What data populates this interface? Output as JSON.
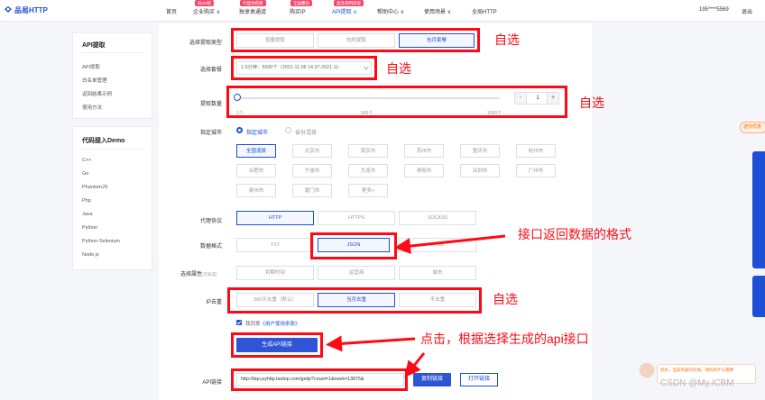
{
  "header": {
    "logo": "品易HTTP",
    "nav": [
      {
        "label": "首页",
        "tag": ""
      },
      {
        "label": "企业购买 ∨",
        "tag": "低40/起"
      },
      {
        "label": "独享类通道",
        "tag": "代理池搭建"
      },
      {
        "label": "购买IP",
        "tag": "全国覆盖"
      },
      {
        "label": "API提取 ∨",
        "tag": "直连调用提取"
      },
      {
        "label": "帮助中心 ∨",
        "tag": ""
      },
      {
        "label": "使用场景 ∨",
        "tag": ""
      },
      {
        "label": "全局HTTP",
        "tag": ""
      }
    ],
    "user": "195****5569",
    "logout": "退出"
  },
  "sidebar_api": {
    "title": "API提取",
    "items": [
      "API提取",
      "白名单管理",
      "返回结果示例",
      "使用方法"
    ]
  },
  "sidebar_demo": {
    "title": "代码接入Demo",
    "items": [
      "C++",
      "Go",
      "PhantomJS",
      "Php",
      "Java",
      "Python",
      "Python-Selenium",
      "Node.js"
    ]
  },
  "form": {
    "package_label": "选择提取类型",
    "package_options": [
      "按量提取",
      "包时提取",
      "包月套餐"
    ],
    "package_selected": 2,
    "choose_label": "选择套餐",
    "choose_value": "1-5分钟：5000个（2021-11-06 14:37-2021-11-",
    "count_label": "提取数量",
    "count_value": "1",
    "slider_min": "1个",
    "slider_mid": "500个",
    "slider_max": "1000个",
    "slider_level": 0,
    "city_label": "指定城市",
    "city_radio1": "指定城市",
    "city_radio2": "省份混拨",
    "cities": [
      "全国混拨",
      "北京市",
      "南京市",
      "苏州市",
      "重庆市",
      "杭州市",
      "合肥市",
      "宁波市",
      "大连市",
      "贵阳市",
      "深圳市",
      "广州市",
      "泉州市",
      "厦门市",
      "更多>"
    ],
    "protocol_label": "代理协议",
    "protocols": [
      "HTTP",
      "HTTPS",
      "SOCKS5"
    ],
    "format_label": "数据格式",
    "formats": [
      "TXT",
      "JSON",
      "HTML"
    ],
    "attr_label": "选择属性",
    "attr_sub": "(可多选)",
    "attrs": [
      "到期时间",
      "运营商",
      "城市"
    ],
    "dedup_label": "IP去重",
    "dedups": [
      "360天去重（默认）",
      "当月去重",
      "不去重"
    ],
    "agree_text": "我同意",
    "agree_link": "《用户使用条款》",
    "generate_btn": "生成API链接",
    "api_label": "API链接",
    "api_url": "http://tiqu.pyhttp.taolop.com/getip?count=1&neek=13875&",
    "copy_btn": "复制链接",
    "open_btn": "打开链接"
  },
  "notes": {
    "n1": "自选",
    "n2": "自选",
    "n3": "自选",
    "n4": "接口返回数据的格式",
    "n5": "自选",
    "n6": "点击，根据选择生成的api接口"
  },
  "right_widget": {
    "badge": "送你优惠"
  },
  "chat": {
    "text": "您好，当前有疑问在线，请问有什么需要"
  },
  "watermark": "CSDN @My.ICBM",
  "colors": {
    "accent": "#1f4fd6",
    "annotation": "#ff0a14",
    "tag": "#f04b6e"
  }
}
